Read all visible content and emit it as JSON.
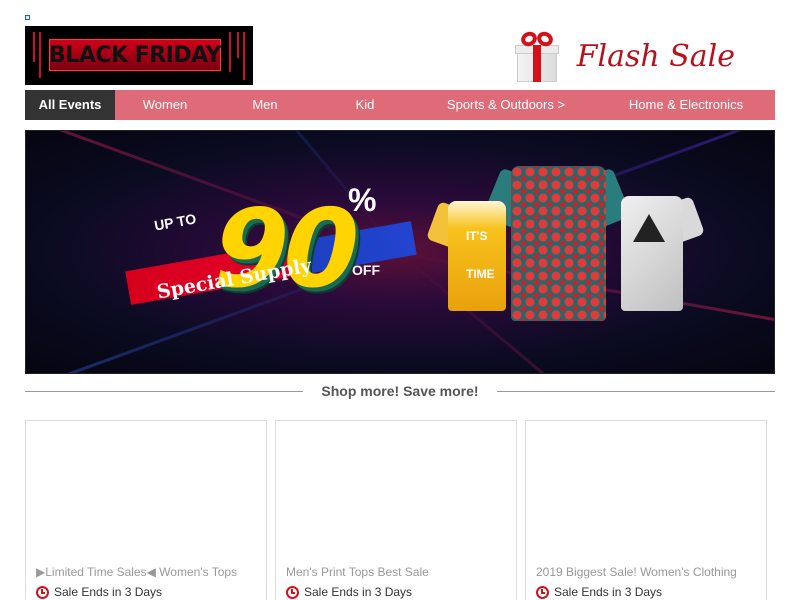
{
  "header": {
    "logo_text": "BLACK FRIDAY",
    "flash_sale": "Flash Sale"
  },
  "nav": {
    "items": [
      {
        "label": "All Events",
        "active": true
      },
      {
        "label": "Women"
      },
      {
        "label": "Men"
      },
      {
        "label": "Kid"
      },
      {
        "label": "Sports & Outdoors >"
      },
      {
        "label": "Home & Electronics"
      }
    ]
  },
  "banner": {
    "up_to": "UP TO",
    "special": "Special Supply",
    "big_number": "90",
    "percent": "%",
    "off": "OFF",
    "shirt_text_1": "IT'S",
    "shirt_text_2": "TIME"
  },
  "section": {
    "divider_text": "Shop more! Save more!"
  },
  "cards": [
    {
      "title": "▶Limited Time Sales◀ Women's Tops",
      "timer": "Sale Ends in 3 Days"
    },
    {
      "title": "Men's Print Tops Best Sale",
      "timer": "Sale Ends in 3 Days"
    },
    {
      "title": "2019 Biggest Sale! Women's Clothing",
      "timer": "Sale Ends in 3 Days"
    }
  ],
  "colors": {
    "nav_bg": "#e06b78",
    "nav_active": "#333333",
    "accent_red": "#b5121b"
  }
}
